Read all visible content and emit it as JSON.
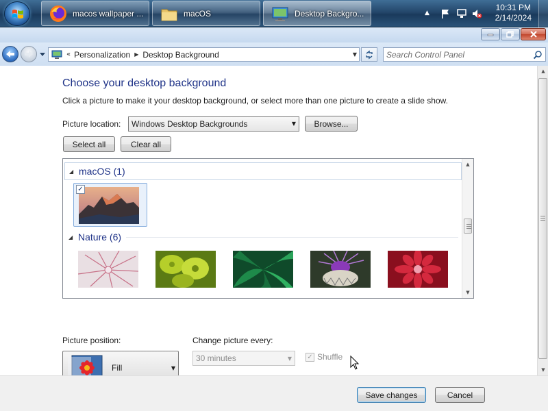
{
  "taskbar": {
    "buttons": [
      {
        "label": "macos wallpaper ...",
        "icon": "firefox-icon"
      },
      {
        "label": "macOS",
        "icon": "folder-icon"
      },
      {
        "label": "Desktop Backgro...",
        "icon": "control-panel-icon"
      }
    ],
    "clock": {
      "time": "10:31 PM",
      "date": "2/14/2024"
    }
  },
  "window": {
    "address": {
      "crumbs": [
        "Personalization",
        "Desktop Background"
      ],
      "overflow": "«"
    },
    "search_placeholder": "Search Control Panel"
  },
  "content": {
    "title": "Choose your desktop background",
    "instructions": "Click a picture to make it your desktop background, or select more than one picture to create a slide show.",
    "picture_location": {
      "label": "Picture location:",
      "value": "Windows Desktop Backgrounds"
    },
    "browse_label": "Browse...",
    "select_all_label": "Select all",
    "clear_all_label": "Clear all",
    "groups": [
      {
        "name": "macOS (1)"
      },
      {
        "name": "Nature (6)"
      }
    ],
    "picture_position": {
      "label": "Picture position:",
      "value": "Fill"
    },
    "change_interval": {
      "label": "Change picture every:",
      "value": "30 minutes"
    },
    "shuffle": {
      "label": "Shuffle",
      "checked": true,
      "enabled": false
    }
  },
  "footer": {
    "save_label": "Save changes",
    "cancel_label": "Cancel"
  },
  "colors": {
    "heading": "#1e3287",
    "taskbar": "#24476b"
  }
}
